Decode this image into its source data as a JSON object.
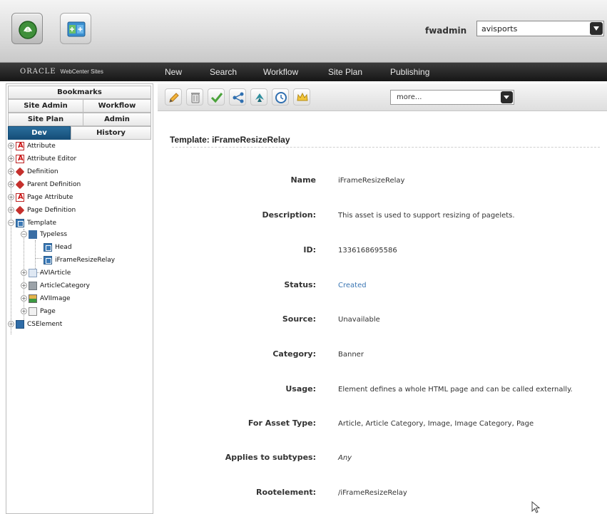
{
  "topbar": {
    "username": "fwadmin",
    "site": "avisports"
  },
  "nav": {
    "logo_brand": "ORACLE",
    "logo_product": "WebCenter Sites",
    "items": [
      "New",
      "Search",
      "Workflow",
      "Site Plan",
      "Publishing"
    ]
  },
  "left_tabs": {
    "bookmarks": "Bookmarks",
    "site_admin": "Site Admin",
    "workflow": "Workflow",
    "site_plan": "Site Plan",
    "admin": "Admin",
    "dev": "Dev",
    "history": "History"
  },
  "tree": [
    {
      "label": "Attribute",
      "icon": "attribute-icon"
    },
    {
      "label": "Attribute Editor",
      "icon": "attribute-editor-icon"
    },
    {
      "label": "Definition",
      "icon": "definition-icon"
    },
    {
      "label": "Parent Definition",
      "icon": "definition-icon"
    },
    {
      "label": "Page Attribute",
      "icon": "attribute-icon"
    },
    {
      "label": "Page Definition",
      "icon": "definition-icon"
    },
    {
      "label": "Template",
      "icon": "template-icon"
    },
    {
      "label": "Typeless",
      "icon": "typeless-icon"
    },
    {
      "label": "Head",
      "icon": "template-icon"
    },
    {
      "label": "iFrameResizeRelay",
      "icon": "template-icon"
    },
    {
      "label": "AVIArticle",
      "icon": "article-icon"
    },
    {
      "label": "ArticleCategory",
      "icon": "category-icon"
    },
    {
      "label": "AVIImage",
      "icon": "image-icon"
    },
    {
      "label": "Page",
      "icon": "page-icon"
    },
    {
      "label": "CSElement",
      "icon": "cselement-icon"
    }
  ],
  "toolbar": {
    "more": "more..."
  },
  "main": {
    "title": "Template: iFrameResizeRelay",
    "fields": [
      {
        "label": "Name",
        "value": "iFrameResizeRelay"
      },
      {
        "label": "Description:",
        "value": "This asset is used to support resizing of pagelets."
      },
      {
        "label": "ID:",
        "value": "1336168695586"
      },
      {
        "label": "Status:",
        "value": "Created"
      },
      {
        "label": "Source:",
        "value": "Unavailable"
      },
      {
        "label": "Category:",
        "value": "Banner"
      },
      {
        "label": "Usage:",
        "value": "Element defines a whole HTML page and can be called externally."
      },
      {
        "label": "For Asset Type:",
        "value": "Article, Article Category, Image, Image Category, Page"
      },
      {
        "label": "Applies to subtypes:",
        "value": "Any"
      },
      {
        "label": "Rootelement:",
        "value": "/iFrameResizeRelay"
      }
    ]
  },
  "colors": {
    "nav_bg": "#1f1f1f",
    "active_tab": "#1a5a86",
    "status_link": "#3b76b3"
  }
}
